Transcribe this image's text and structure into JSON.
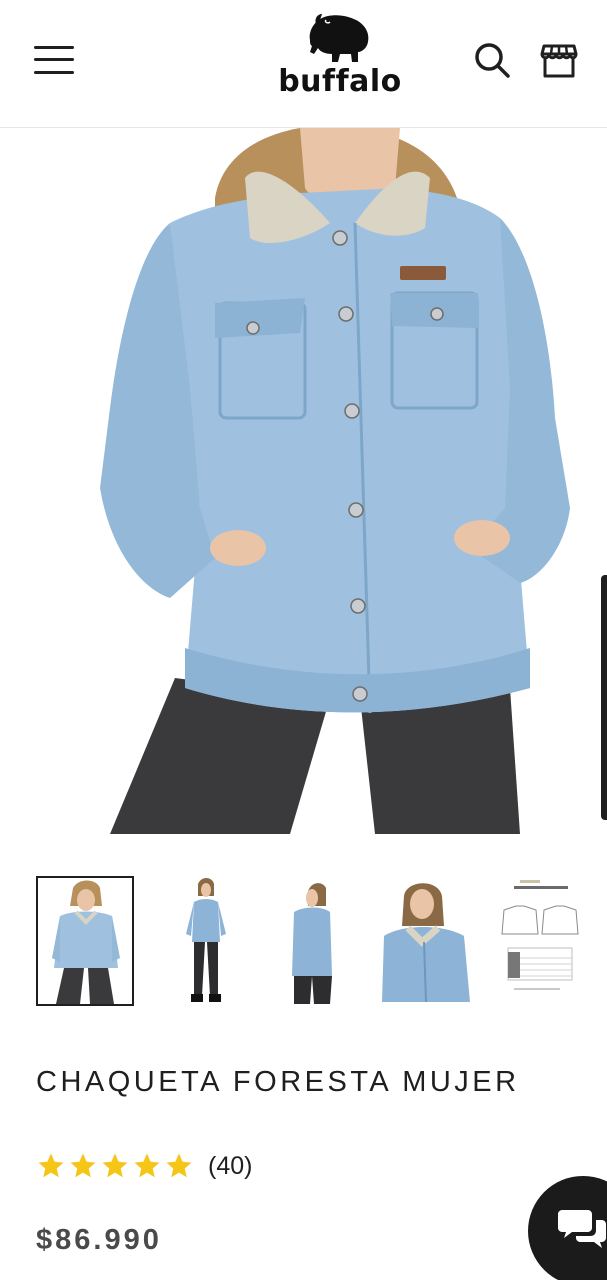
{
  "header": {
    "menu_icon": "hamburger-menu-icon",
    "logo_text": "buffalo",
    "logo_icon": "buffalo-logo-icon",
    "search_icon": "search-icon",
    "store_icon": "store-icon"
  },
  "product": {
    "title": "CHAQUETA FORESTA MUJER",
    "rating": 5,
    "rating_max": 5,
    "review_count": "(40)",
    "price": "$86.990"
  },
  "gallery": {
    "thumbnail_count": 5,
    "active_index": 0
  },
  "chat": {
    "icon": "chat-bubbles-icon"
  },
  "colors": {
    "denim": "#9fc1df",
    "denim_dark": "#7ea6c9",
    "jeans": "#3a3a3c",
    "star": "#f5c518",
    "text": "#1f1f1f",
    "price": "#4a4a4a"
  }
}
